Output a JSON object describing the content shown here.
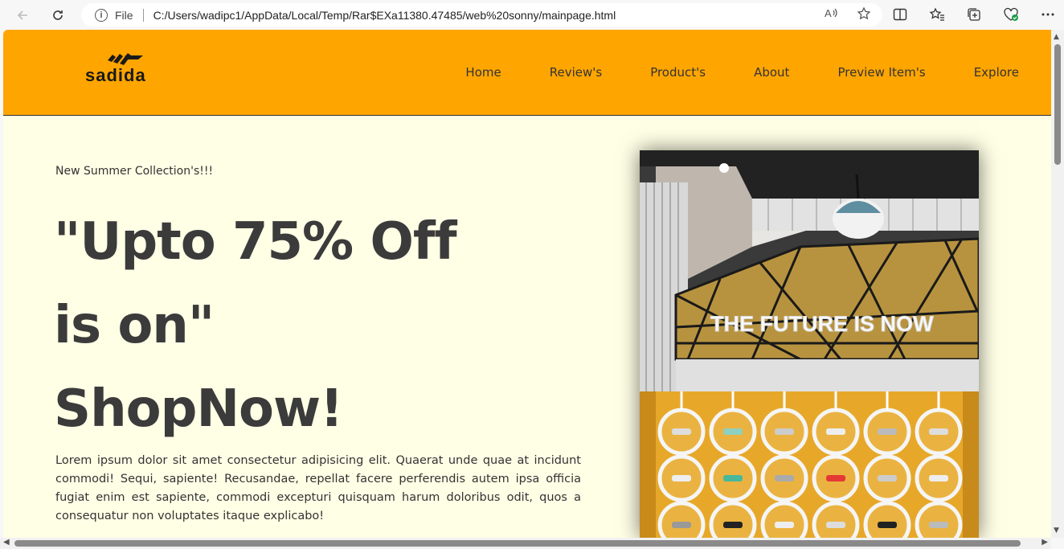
{
  "browser": {
    "file_label": "File",
    "url": "C:/Users/wadipc1/AppData/Local/Temp/Rar$EXa11380.47485/web%20sonny/mainpage.html"
  },
  "site": {
    "brand": "sadida",
    "nav": [
      "Home",
      "Review's",
      "Product's",
      "About",
      "Preview Item's",
      "Explore"
    ],
    "hero": {
      "subtitle": "New Summer Collection's!!!",
      "title_lines": [
        "\"Upto 75% Off",
        "is on\"",
        "ShopNow!"
      ],
      "description": "Lorem ipsum dolor sit amet consectetur adipisicing elit. Quaerat unde quae at incidunt commodi! Sequi, sapiente! Recusandae, repellat facere perferendis autem ipsa officia fugiat enim est sapiente, commodi excepturi quisquam harum doloribus odit, quos a consequatur non voluptates itaque explicabo!",
      "image_sign_text": "THE FUTURE IS NOW"
    }
  },
  "colors": {
    "header_bg": "#ffa500",
    "page_bg": "#ffffe6",
    "title_text": "#3b3b3b"
  },
  "icons": {
    "back": "back-arrow-icon",
    "refresh": "refresh-icon",
    "info": "info-icon",
    "read_aloud": "read-aloud-icon",
    "favorite": "star-icon",
    "split": "split-screen-icon",
    "favorites": "favorites-icon",
    "collections": "collections-icon",
    "health": "browser-essentials-icon",
    "more": "more-icon"
  }
}
